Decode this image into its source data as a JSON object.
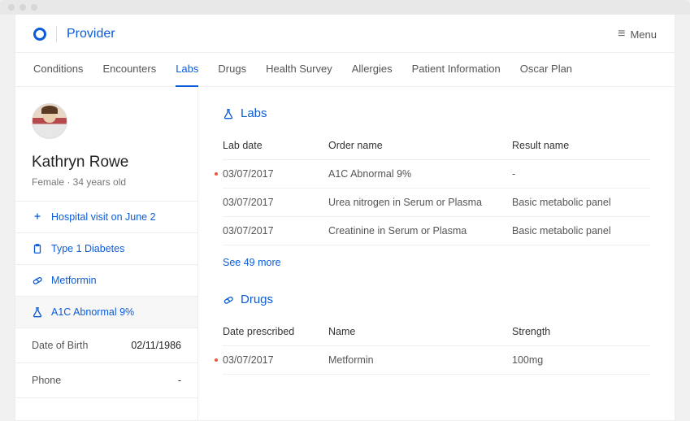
{
  "header": {
    "brand_title": "Provider",
    "menu_label": "Menu"
  },
  "tabs": [
    {
      "label": "Conditions",
      "active": false
    },
    {
      "label": "Encounters",
      "active": false
    },
    {
      "label": "Labs",
      "active": true
    },
    {
      "label": "Drugs",
      "active": false
    },
    {
      "label": "Health Survey",
      "active": false
    },
    {
      "label": "Allergies",
      "active": false
    },
    {
      "label": "Patient Information",
      "active": false
    },
    {
      "label": "Oscar Plan",
      "active": false
    }
  ],
  "patient": {
    "name": "Kathryn Rowe",
    "meta": "Female · 34 years old",
    "dob_label": "Date of Birth",
    "dob_value": "02/11/1986",
    "phone_label": "Phone",
    "phone_value": "-"
  },
  "sidebar_items": [
    {
      "icon": "hospital",
      "label": "Hospital visit on June 2"
    },
    {
      "icon": "clipboard",
      "label": "Type 1 Diabetes"
    },
    {
      "icon": "pill",
      "label": "Metformin"
    },
    {
      "icon": "flask",
      "label": "A1C Abnormal 9%",
      "active": true
    }
  ],
  "labs": {
    "title": "Labs",
    "columns": {
      "c1": "Lab date",
      "c2": "Order name",
      "c3": "Result name"
    },
    "rows": [
      {
        "flag": true,
        "date": "03/07/2017",
        "order": "A1C Abnormal 9%",
        "result": "-"
      },
      {
        "flag": false,
        "date": "03/07/2017",
        "order": "Urea nitrogen in Serum or Plasma",
        "result": "Basic metabolic panel"
      },
      {
        "flag": false,
        "date": "03/07/2017",
        "order": "Creatinine in Serum or Plasma",
        "result": "Basic metabolic panel"
      }
    ],
    "see_more": "See 49 more"
  },
  "drugs": {
    "title": "Drugs",
    "columns": {
      "c1": "Date prescribed",
      "c2": "Name",
      "c3": "Strength"
    },
    "rows": [
      {
        "flag": true,
        "date": "03/07/2017",
        "name": "Metformin",
        "strength": "100mg"
      }
    ]
  }
}
